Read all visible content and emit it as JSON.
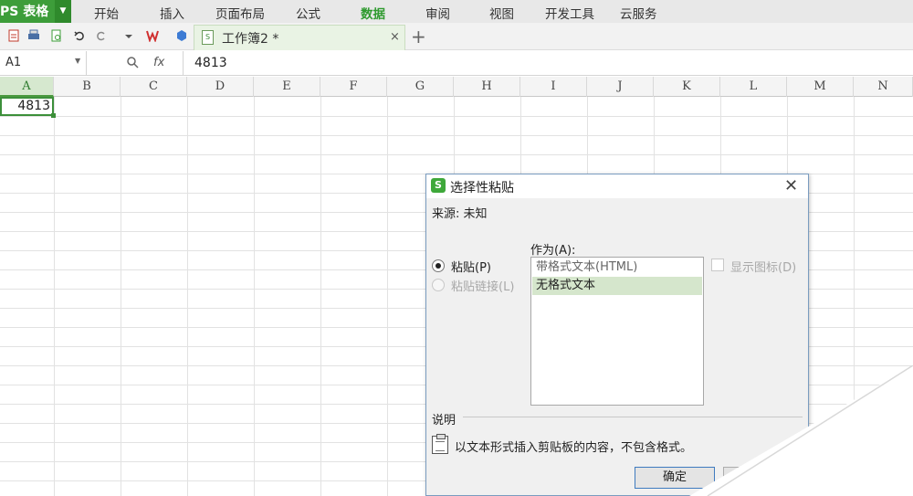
{
  "app": {
    "title": "PS 表格",
    "brand_color": "#3d9d3a"
  },
  "menu": {
    "items": [
      "开始",
      "插入",
      "页面布局",
      "公式",
      "数据",
      "审阅",
      "视图",
      "开发工具",
      "云服务"
    ],
    "active": "数据"
  },
  "tabs": {
    "document": "工作簿2 *",
    "close": "×",
    "new": "+"
  },
  "formula_bar": {
    "cell_ref": "A1",
    "fx": "fx",
    "value": "4813"
  },
  "grid": {
    "columns": [
      "A",
      "B",
      "C",
      "D",
      "E",
      "F",
      "G",
      "H",
      "I",
      "J",
      "K",
      "L",
      "M",
      "N"
    ],
    "selected_column": "A",
    "a1_value": "4813"
  },
  "dialog": {
    "title": "选择性粘贴",
    "close": "✕",
    "source": "来源: 未知",
    "as_label": "作为(A):",
    "paste_label": "粘贴(P)",
    "paste_link_label": "粘贴链接(L)",
    "show_icon_label": "显示图标(D)",
    "formats": [
      "带格式文本(HTML)",
      "无格式文本"
    ],
    "selected_format": "无格式文本",
    "desc_header": "说明",
    "desc_text": "以文本形式插入剪贴板的内容，不包含格式。",
    "ok_label": "确定"
  }
}
